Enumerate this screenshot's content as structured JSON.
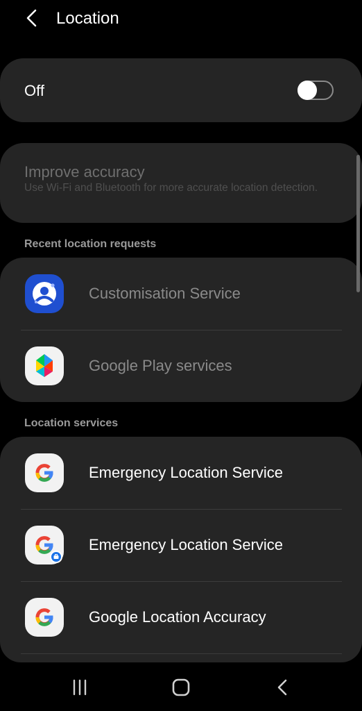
{
  "header": {
    "title": "Location",
    "back_icon": "chevron-left-icon"
  },
  "master_switch": {
    "label": "Off",
    "state": "off"
  },
  "improve_accuracy": {
    "title": "Improve accuracy",
    "description": "Use Wi-Fi and Bluetooth for more accurate location detection."
  },
  "recent_requests": {
    "header": "Recent location requests",
    "items": [
      {
        "label": "Customisation Service",
        "icon": "customisation-service-icon"
      },
      {
        "label": "Google Play services",
        "icon": "google-play-services-icon"
      }
    ]
  },
  "location_services": {
    "header": "Location services",
    "items": [
      {
        "label": "Emergency Location Service",
        "icon": "google-g-icon"
      },
      {
        "label": "Emergency Location Service",
        "icon": "google-g-work-icon"
      },
      {
        "label": "Google Location Accuracy",
        "icon": "google-g-icon"
      }
    ]
  },
  "navbar": {
    "recents": "recent-apps-icon",
    "home": "home-icon",
    "back": "back-icon"
  },
  "colors": {
    "background": "#000000",
    "card": "#252525",
    "text_primary": "#ffffff",
    "text_dim": "#8a8a8a",
    "section_header": "#9a9a9a",
    "customisation_blue": "#1f4fd0"
  }
}
